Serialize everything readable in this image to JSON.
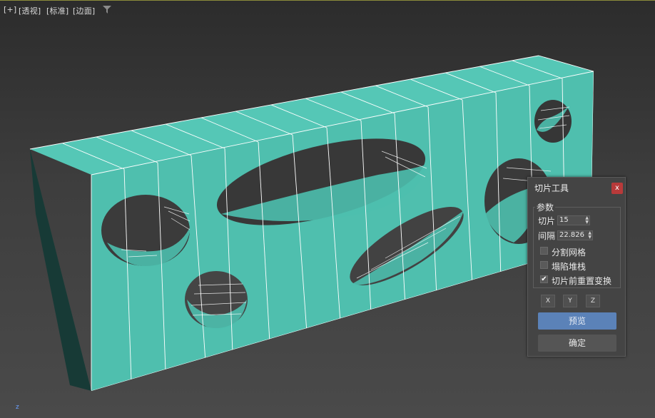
{
  "viewport": {
    "menu_plus": "[+]",
    "menu_view": "[透视]",
    "menu_shading": "[标准]",
    "menu_edges": "[边面]",
    "filter_icon": "filter-funnel-icon",
    "axis_label": "z",
    "object_color": "#4dbfae",
    "background_color": "#3c3c3c"
  },
  "dialog": {
    "title": "切片工具",
    "close_label": "x",
    "group_label": "参数",
    "slices_label": "切片",
    "slices_value": "15",
    "spacing_label": "间隔",
    "spacing_value": "22.826",
    "split_mesh_label": "分割网格",
    "split_mesh_checked": false,
    "collapse_stack_label": "塌陷堆栈",
    "collapse_stack_checked": false,
    "reset_xform_label": "切片前重置变换",
    "reset_xform_checked": true,
    "axis_x": "X",
    "axis_y": "Y",
    "axis_z": "Z",
    "preview_label": "预览",
    "ok_label": "确定",
    "accent_color": "#5b82b8"
  }
}
